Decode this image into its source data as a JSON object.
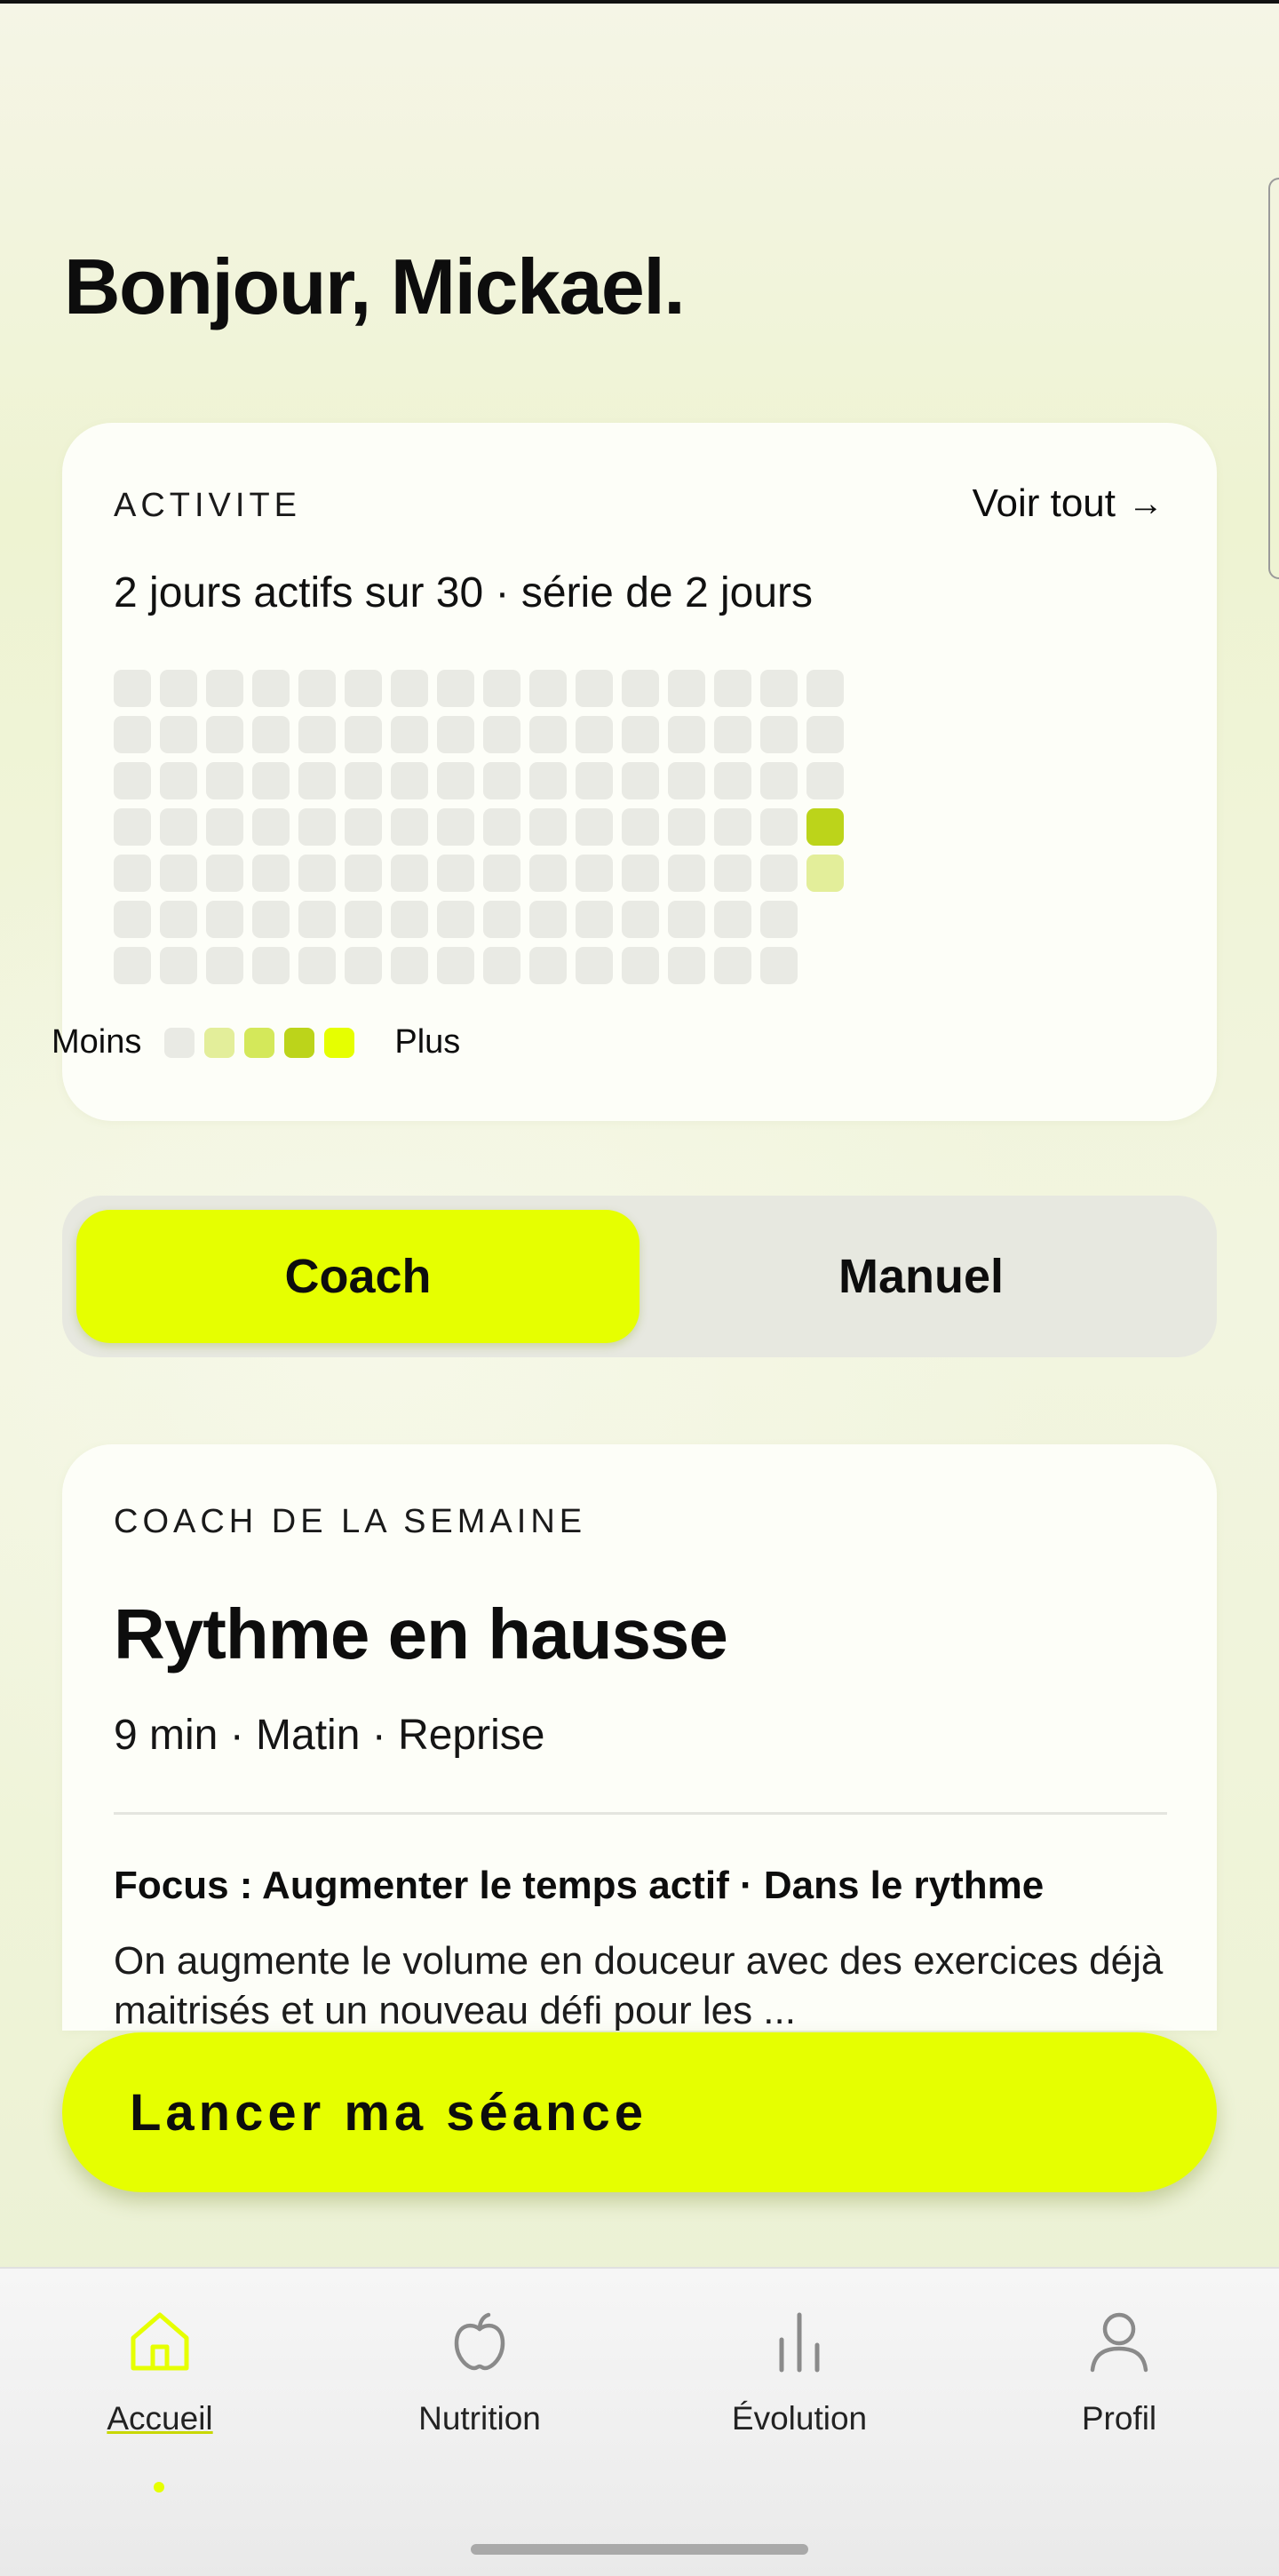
{
  "greeting": "Bonjour, Mickael.",
  "activity": {
    "overline": "ACTIVITE",
    "see_all": "Voir tout",
    "see_all_icon": "arrow-right-icon",
    "summary": "2 jours actifs sur 30 · série de 2 jours",
    "legend_less": "Moins",
    "legend_more": "Plus",
    "legend_colors": [
      "#e9eae4",
      "#e3ee9a",
      "#d4e85a",
      "#bcd41a",
      "#e6ff00"
    ],
    "active_cells": [
      {
        "col": 15,
        "row": 3,
        "level": 4,
        "color": "#bcd41a"
      },
      {
        "col": 15,
        "row": 4,
        "level": 1,
        "color": "#e3ee9a"
      }
    ]
  },
  "mode": {
    "options": [
      "Coach",
      "Manuel"
    ],
    "selected": "Coach"
  },
  "coach": {
    "overline": "COACH DE LA SEMAINE",
    "title": "Rythme en hausse",
    "meta": "9 min · Matin · Reprise",
    "focus": "Focus : Augmenter le temps actif · Dans le rythme",
    "description": "On augmente le volume en douceur avec des exercices déjà maitrisés et un nouveau défi pour les ..."
  },
  "cta": {
    "label": "Lancer ma séance"
  },
  "tabs": [
    {
      "label": "Accueil",
      "icon": "home-icon",
      "active": true
    },
    {
      "label": "Nutrition",
      "icon": "apple-icon",
      "active": false
    },
    {
      "label": "Évolution",
      "icon": "bar-chart-icon",
      "active": false
    },
    {
      "label": "Profil",
      "icon": "person-icon",
      "active": false
    }
  ],
  "colors": {
    "accent": "#e6ff00",
    "accent_dark": "#bcd41a",
    "empty_cell": "#e9eae4"
  }
}
